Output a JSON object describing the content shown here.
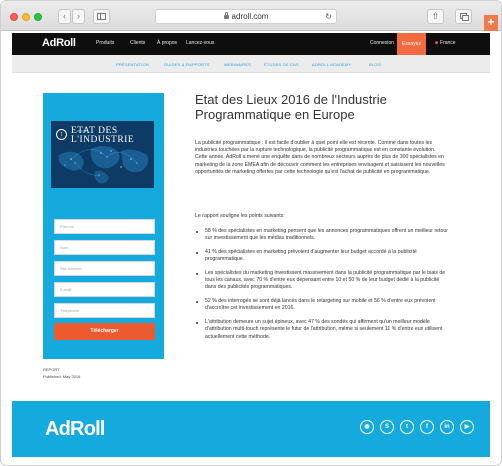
{
  "browser": {
    "url": "adroll.com",
    "reload_glyph": "↻",
    "back_glyph": "‹",
    "forward_glyph": "›",
    "new_tab_glyph": "+",
    "share_glyph": "⇧"
  },
  "nav": {
    "logo": "AdRoll",
    "links": [
      "Produits",
      "Clients",
      "À propos",
      "Lancez-vous"
    ],
    "connexion": "Connexion",
    "essayez": "Essayez",
    "country": "France",
    "background_color": "#0e0e0e",
    "accent_color": "#f26a3d"
  },
  "subnav": {
    "items": [
      "PRÉSENTATION",
      "GUIDES & RAPPORTS",
      "WEBINAIRES",
      "ÉTUDES DE CAS",
      "ADROLL ACADEMY",
      "BLOG"
    ],
    "link_color": "#1ba1e2"
  },
  "hero": {
    "cover_line1": "ETAT DES",
    "cover_line2": "L'INDUSTRIE",
    "cover_subtitle": "2016 DE",
    "background_color": "#15aade"
  },
  "form": {
    "fields": [
      "Prénom",
      "Nom",
      "Site Internet",
      "E-mail",
      "Téléphone"
    ],
    "submit_label": "Télécharger",
    "submit_color": "#ee5a30"
  },
  "meta": {
    "type": "REPORT",
    "published": "Published: May 2016"
  },
  "article": {
    "title": "Etat des Lieux 2016 de l'Industrie Programmatique en Europe",
    "intro": "La publicité programmatique : il est facile d'oublier à quel point elle est récente. Comme dans toutes les industries touchées par la rupture technologique, la publicité programmatique est en constante évolution. Cette année, AdRoll a mené une enquête dans de nombreux secteurs auprès de plus de 300 spécialistes en marketing de la zone EMEA afin de découvrir comment les entreprises envisagent et saisissent les nouvelles opportunités de marketing offertes par cette technologie qu'est l'achat de publicité en programmatique.",
    "lead": "Le rapport souligne les points suivants:",
    "bullets": [
      "58 % des spécialistes en marketing pensent que les annonces programmatiques offrent un meilleur retour sur investissement que les médias traditionnels.",
      "41 % des spécialistes en marketing prévoient d'augmenter leur budget accordé à la publicité programmatique.",
      "Les spécialistes du marketing investissent massivement dans la publicité programmatique par le biais de tous les canaux, avec 70 % d'entre eux dépensant entre 10 et 50 % de leur budget dédié à la publicité dans des publicités programmatiques.",
      "52 % des interrogés se sont déjà lancés dans le retargeting sur mobile et 56 % d'entre eux prévoient d'accroître cet investissement en 2016.",
      "L'attribution demeure un sujet épineux, avec 47 % des sondés qui affirment qu'un meilleur modèle d'attribution multi-touch représente le futur de l'attribution, même si seulement 11 % d'entre eux utilisent actuellement cette méthode."
    ]
  },
  "footer": {
    "logo": "AdRoll",
    "background_color": "#15aade",
    "social": [
      {
        "icon": "rss-icon",
        "glyph": "◉"
      },
      {
        "icon": "skype-icon",
        "glyph": "S"
      },
      {
        "icon": "twitter-icon",
        "glyph": "t"
      },
      {
        "icon": "facebook-icon",
        "glyph": "f"
      },
      {
        "icon": "linkedin-icon",
        "glyph": "in"
      },
      {
        "icon": "youtube-icon",
        "glyph": "▶"
      }
    ]
  }
}
